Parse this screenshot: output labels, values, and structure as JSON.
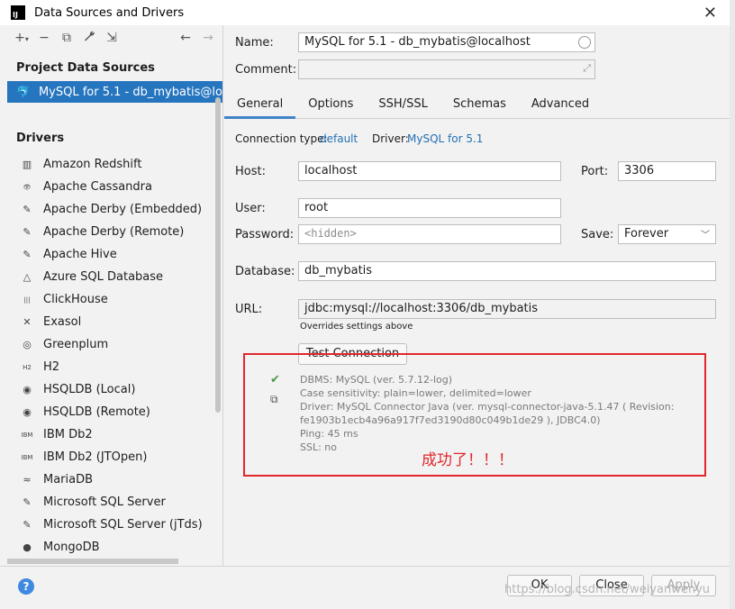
{
  "window": {
    "title": "Data Sources and Drivers",
    "app_icon": "IJ"
  },
  "sidebar": {
    "toolbar": [
      {
        "icon": "add-icon",
        "glyph": "+"
      },
      {
        "icon": "remove-icon",
        "glyph": "−"
      },
      {
        "icon": "duplicate-icon",
        "glyph": "⧉"
      },
      {
        "icon": "wrench-icon",
        "glyph": "🔧"
      },
      {
        "icon": "import-icon",
        "glyph": "⇲"
      },
      {
        "icon": "back-arrow-icon",
        "glyph": "←"
      },
      {
        "icon": "forward-arrow-icon",
        "glyph": "→"
      }
    ],
    "project_heading": "Project Data Sources",
    "selected_source": "MySQL for 5.1 - db_mybatis@localhost",
    "drivers_heading": "Drivers",
    "drivers": [
      {
        "label": "Amazon Redshift",
        "icon": "▥"
      },
      {
        "label": "Apache Cassandra",
        "icon": "👁"
      },
      {
        "label": "Apache Derby (Embedded)",
        "icon": "✎"
      },
      {
        "label": "Apache Derby (Remote)",
        "icon": "✎"
      },
      {
        "label": "Apache Hive",
        "icon": "✎"
      },
      {
        "label": "Azure SQL Database",
        "icon": "△"
      },
      {
        "label": "ClickHouse",
        "icon": "|||"
      },
      {
        "label": "Exasol",
        "icon": "✕"
      },
      {
        "label": "Greenplum",
        "icon": "◎"
      },
      {
        "label": "H2",
        "icon": "H2"
      },
      {
        "label": "HSQLDB (Local)",
        "icon": "◉"
      },
      {
        "label": "HSQLDB (Remote)",
        "icon": "◉"
      },
      {
        "label": "IBM Db2",
        "icon": "IBM"
      },
      {
        "label": "IBM Db2 (JTOpen)",
        "icon": "IBM"
      },
      {
        "label": "MariaDB",
        "icon": "≈"
      },
      {
        "label": "Microsoft SQL Server",
        "icon": "✎"
      },
      {
        "label": "Microsoft SQL Server (jTds)",
        "icon": "✎"
      },
      {
        "label": "MongoDB",
        "icon": "●"
      }
    ]
  },
  "form": {
    "name_label": "Name:",
    "name_value": "MySQL for 5.1 - db_mybatis@localhost",
    "comment_label": "Comment:",
    "tabs": [
      "General",
      "Options",
      "SSH/SSL",
      "Schemas",
      "Advanced"
    ],
    "active_tab": "General",
    "connection_type_label": "Connection type:",
    "connection_type_value": "default",
    "driver_label": "Driver:",
    "driver_value": "MySQL for 5.1",
    "host_label": "Host:",
    "host_value": "localhost",
    "port_label": "Port:",
    "port_value": "3306",
    "user_label": "User:",
    "user_value": "root",
    "password_label": "Password:",
    "password_placeholder": "<hidden>",
    "save_label": "Save:",
    "save_value": "Forever",
    "database_label": "Database:",
    "database_value": "db_mybatis",
    "url_label": "URL:",
    "url_value": "jdbc:mysql://localhost:3306/db_mybatis",
    "url_note": "Overrides settings above",
    "test_button": "Test Connection"
  },
  "result": {
    "lines": [
      "DBMS: MySQL (ver. 5.7.12-log)",
      "Case sensitivity: plain=lower, delimited=lower",
      "Driver: MySQL Connector Java (ver. mysql-connector-java-5.1.47 ( Revision:",
      "fe1903b1ecb4a96a917f7ed3190d80c049b1de29 ), JDBC4.0)",
      "Ping: 45 ms",
      "SSL: no"
    ],
    "annotation": "成功了！！！"
  },
  "footer": {
    "ok": "OK",
    "close": "Close",
    "apply": "Apply",
    "help_icon": "?",
    "watermark": "https://blog.csdn.net/weiyanwenyu"
  },
  "colors": {
    "selection": "#2675bf",
    "link": "#2470b3",
    "annotation": "#e0282c"
  }
}
